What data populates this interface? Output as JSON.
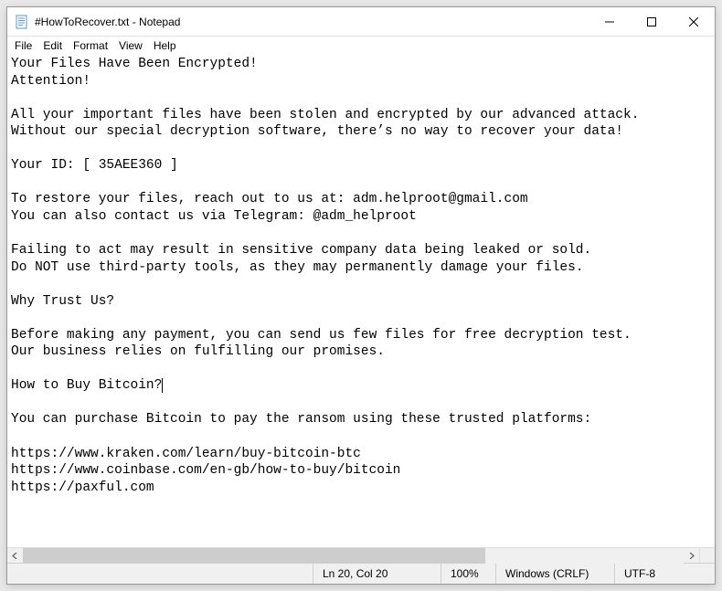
{
  "window": {
    "title": "#HowToRecover.txt - Notepad"
  },
  "menu": {
    "file": "File",
    "edit": "Edit",
    "format": "Format",
    "view": "View",
    "help": "Help"
  },
  "document": {
    "lines": [
      "Your Files Have Been Encrypted!",
      "Attention!",
      "",
      "All your important files have been stolen and encrypted by our advanced attack.",
      "Without our special decryption software, there’s no way to recover your data!",
      "",
      "Your ID: [ 35AEE360 ]",
      "",
      "To restore your files, reach out to us at: adm.helproot@gmail.com",
      "You can also contact us via Telegram: @adm_helproot",
      "",
      "Failing to act may result in sensitive company data being leaked or sold.",
      "Do NOT use third-party tools, as they may permanently damage your files.",
      "",
      "Why Trust Us?",
      "",
      "Before making any payment, you can send us few files for free decryption test.",
      "Our business relies on fulfilling our promises.",
      "",
      "How to Buy Bitcoin?",
      "",
      "You can purchase Bitcoin to pay the ransom using these trusted platforms:",
      "",
      "https://www.kraken.com/learn/buy-bitcoin-btc",
      "https://www.coinbase.com/en-gb/how-to-buy/bitcoin",
      "https://paxful.com"
    ],
    "caret_line_index": 19,
    "caret_col": 19
  },
  "status": {
    "position": "Ln 20, Col 20",
    "zoom": "100%",
    "line_ending": "Windows (CRLF)",
    "encoding": "UTF-8"
  }
}
